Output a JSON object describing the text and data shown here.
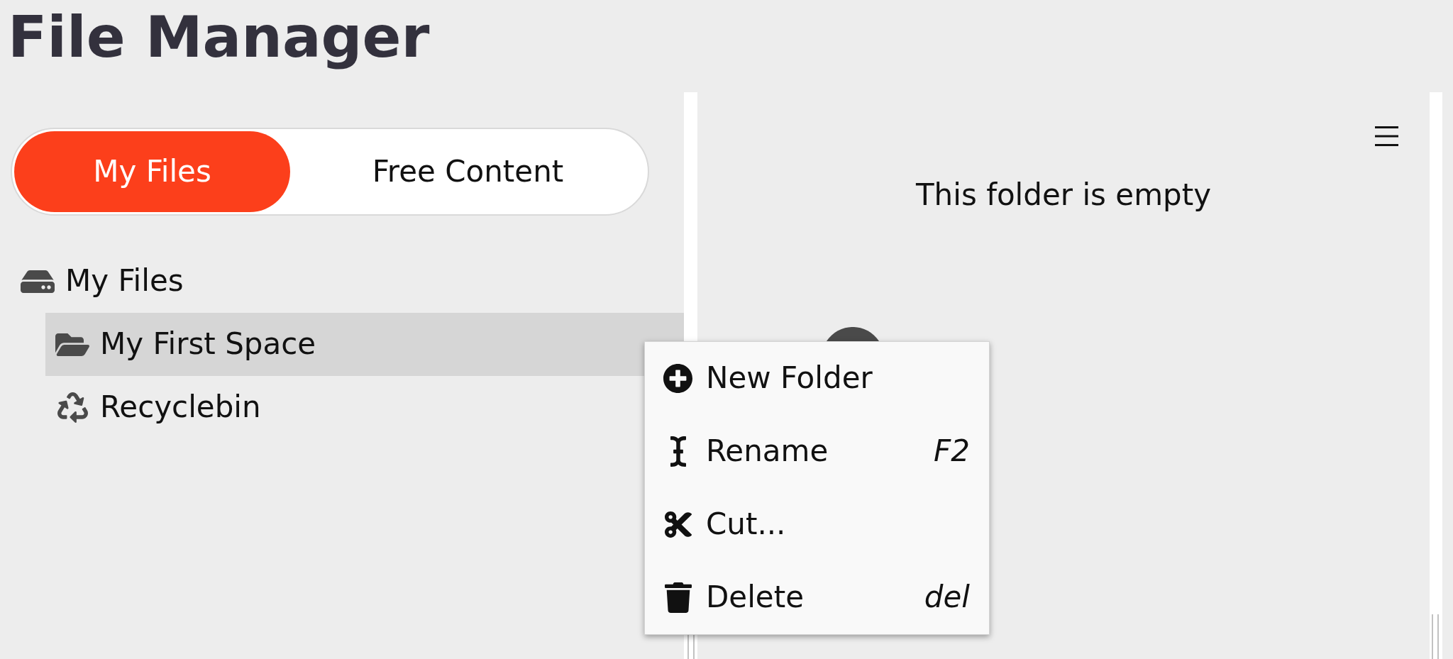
{
  "title": "File Manager",
  "source_tabs": [
    {
      "label": "My Files",
      "selected": true
    },
    {
      "label": "Free Content",
      "selected": false
    }
  ],
  "tree": [
    {
      "label": "My Files",
      "kind": "drive",
      "selected": false,
      "children": [
        {
          "label": "My First Space",
          "kind": "folder",
          "selected": true
        },
        {
          "label": "Recyclebin",
          "kind": "recyclebin",
          "selected": false
        }
      ]
    }
  ],
  "content": {
    "empty_message": "This folder is empty"
  },
  "context_menu": {
    "items": [
      {
        "kind": "new-folder",
        "label": "New Folder"
      },
      {
        "kind": "rename",
        "label": "Rename",
        "shortcut": "F2"
      },
      {
        "kind": "cut",
        "label": "Cut..."
      },
      {
        "kind": "delete",
        "label": "Delete",
        "shortcut": "del"
      }
    ]
  }
}
